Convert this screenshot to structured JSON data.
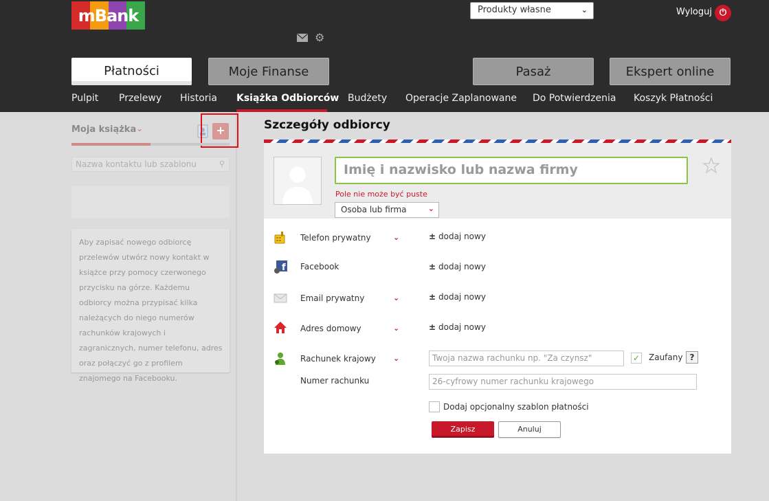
{
  "header": {
    "logo_text": "mBank",
    "products_select": "Produkty własne",
    "logout_label": "Wyloguj",
    "main_tabs": [
      "Płatności",
      "Moje Finanse",
      "Pasaż",
      "Ekspert online"
    ],
    "subnav": [
      "Pulpit",
      "Przelewy",
      "Historia",
      "Książka Odbiorców",
      "Budżety",
      "Operacje Zaplanowane",
      "Do Potwierdzenia",
      "Koszyk Płatności"
    ]
  },
  "sidebar": {
    "title": "Moja książka",
    "add_label": "+",
    "progress": 0.5,
    "search_placeholder": "Nazwa kontaktu lub szablonu",
    "info_text": "Aby zapisać nowego odbiorcę przelewów utwórz nowy kontakt w książce przy pomocy czerwonego przycisku na górze. Każdemu odbiorcy można przypisać kilka należących do niego numerów rachunków krajowych i zagranicznych, numer telefonu, adres oraz połączyć go z profilem znajomego na Facebooku."
  },
  "details": {
    "title": "Szczegóły odbiorcy",
    "name_placeholder": "Imię i nazwisko lub nazwa firmy",
    "name_error": "Pole nie może być puste",
    "type_select": "Osoba lub firma",
    "rows": [
      {
        "label": "Telefon prywatny",
        "add": "dodaj nowy"
      },
      {
        "label": "Facebook",
        "add": "dodaj nowy"
      },
      {
        "label": "Email prywatny",
        "add": "dodaj nowy"
      },
      {
        "label": "Adres domowy",
        "add": "dodaj nowy"
      }
    ],
    "account": {
      "label": "Rachunek krajowy",
      "number_label": "Numer rachunku",
      "name_placeholder": "Twoja nazwa rachunku np. \"Za czynsz\"",
      "trusted_label": "Zaufany",
      "trusted_checked": true,
      "help_label": "?",
      "number_placeholder": "26-cyfrowy numer rachunku krajowego"
    },
    "template_label": "Dodaj opcjonalny szablon płatności",
    "save_label": "Zapisz",
    "cancel_label": "Anuluj"
  },
  "colors": {
    "brand_red": "#c8182a",
    "header_bg": "#2c2c2c",
    "valid_green": "#8cc63f"
  }
}
